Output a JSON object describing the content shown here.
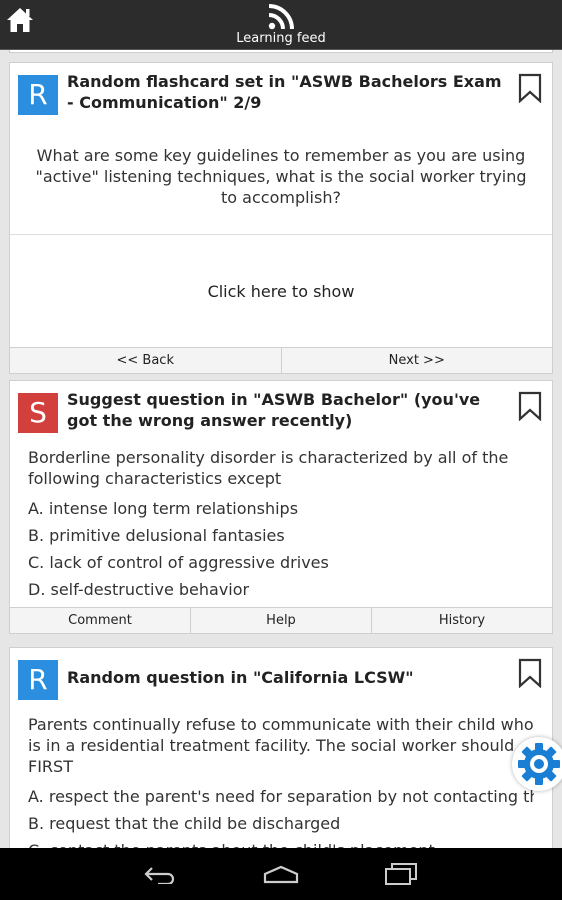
{
  "header": {
    "title": "Learning feed"
  },
  "cards": [
    {
      "badge": "R",
      "title": "Random flashcard set in \"ASWB Bachelors Exam - Communication\" 2/9",
      "question": "What are some key guidelines to remember as you are using \"active\" listening techniques, what is the social worker trying to accomplish?",
      "reveal_label": "Click here to show",
      "prev_label": "<< Back",
      "next_label": "Next >>"
    },
    {
      "badge": "S",
      "title": "Suggest question in \"ASWB Bachelor\" (you've got the wrong answer recently)",
      "question": "Borderline personality disorder is characterized by all of the following characteristics except",
      "answers": [
        "A. intense long term relationships",
        "B. primitive delusional fantasies",
        "C. lack of control of aggressive drives",
        "D. self-destructive behavior"
      ],
      "comment_label": "Comment",
      "help_label": "Help",
      "history_label": "History"
    },
    {
      "badge": "R",
      "title": "Random question in \"California LCSW\"",
      "question": "Parents continually refuse to communicate with their child who is in a residential treatment facility. The social worker should FIRST",
      "answers": [
        "A. respect the parent's need for separation by not contacting them",
        "B. request that the child be discharged",
        "C. contact the parents about the child's placement"
      ]
    }
  ],
  "icons": {
    "home": "home-icon",
    "feed": "rss-icon",
    "bookmark": "bookmark-icon",
    "gear": "gear-icon",
    "back": "back-icon",
    "nav_home": "nav-home-icon",
    "recents": "recents-icon"
  },
  "colors": {
    "badge_blue": "#2b8ede",
    "badge_red": "#d2403e",
    "gear_blue": "#1a7fd4",
    "topbar": "#2c2c2c"
  }
}
